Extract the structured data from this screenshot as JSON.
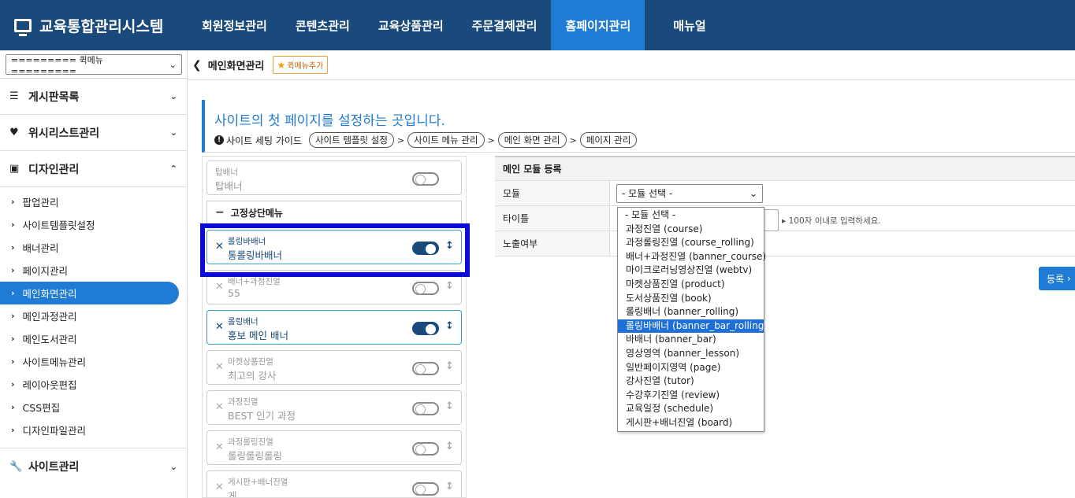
{
  "app": {
    "title": "교육통합관리시스템"
  },
  "nav": {
    "items": [
      {
        "label": "회원정보관리"
      },
      {
        "label": "콘텐츠관리"
      },
      {
        "label": "교육상품관리"
      },
      {
        "label": "주문결제관리"
      },
      {
        "label": "홈페이지관리",
        "active": true
      },
      {
        "label": "매뉴얼"
      }
    ]
  },
  "sidebar": {
    "quick_menu": "========= 퀵메뉴 =========",
    "sections": [
      {
        "label": "게시판목록"
      },
      {
        "label": "위시리스트관리"
      },
      {
        "label": "디자인관리"
      }
    ],
    "sub_items": [
      {
        "label": "팝업관리"
      },
      {
        "label": "사이트템플릿설정"
      },
      {
        "label": "배너관리"
      },
      {
        "label": "페이지관리"
      },
      {
        "label": "메인화면관리",
        "active": true
      },
      {
        "label": "메인과정관리"
      },
      {
        "label": "메인도서관리"
      },
      {
        "label": "사이트메뉴관리"
      },
      {
        "label": "레이아웃편집"
      },
      {
        "label": "CSS편집"
      },
      {
        "label": "디자인파일관리"
      }
    ],
    "bottom_section": "사이트관리"
  },
  "breadcrumb": {
    "title": "메인화면관리",
    "fav_button": "퀵메뉴추가"
  },
  "header": {
    "heading": "사이트의 첫 페이지를 설정하는 곳입니다.",
    "guide_label": "사이트 세팅 가이드",
    "guide_steps": [
      "사이트 템플릿 설정",
      "사이트 메뉴 관리",
      "메인 화면 관리",
      "페이지 관리"
    ]
  },
  "modules": {
    "top_banner": {
      "t1": "탑배너",
      "t2": "탑배너"
    },
    "group_label": "고정상단메뉴",
    "items": [
      {
        "t1": "롤링바배너",
        "t2": "통롤링바배너",
        "on": true
      },
      {
        "t1": "배너+과정진열",
        "t2": "55",
        "on": false
      },
      {
        "t1": "롤링배너",
        "t2": "홍보 메인 배너",
        "on": true
      },
      {
        "t1": "마켓상품진열",
        "t2": "최고의 강사",
        "on": false
      },
      {
        "t1": "과정진열",
        "t2": "BEST 인기 과정",
        "on": false
      },
      {
        "t1": "과정롤링진열",
        "t2": "롤링롤링롤링",
        "on": false
      },
      {
        "t1": "게시판+배너진열",
        "t2": "게",
        "on": false
      }
    ]
  },
  "form": {
    "title": "메인 모듈 등록",
    "module_label": "모듈",
    "module_selected": "- 모듈 선택 -",
    "title_label": "타이틀",
    "title_hint": "100자 이내로 입력하세요.",
    "exposure_label": "노출여부",
    "submit_label": "등록"
  },
  "dropdown": {
    "options": [
      "- 모듈 선택 -",
      "과정진열 (course)",
      "과정롤링진열 (course_rolling)",
      "배너+과정진열 (banner_course)",
      "마이크로러닝영상진열 (webtv)",
      "마켓상품진열 (product)",
      "도서상품진열 (book)",
      "롤링배너 (banner_rolling)",
      "롤링바배너 (banner_bar_rolling)",
      "바배너 (banner_bar)",
      "영상영역 (banner_lesson)",
      "일반페이지영역 (page)",
      "강사진열 (tutor)",
      "수강후기진열 (review)",
      "교육일정 (schedule)",
      "게시판+배너진열 (board)"
    ],
    "highlighted": "롤링바배너 (banner_bar_rolling)"
  },
  "colors": {
    "nav_bg": "#1a4a7c",
    "accent": "#1f7bd3",
    "highlight_box": "#0b0bd4"
  }
}
